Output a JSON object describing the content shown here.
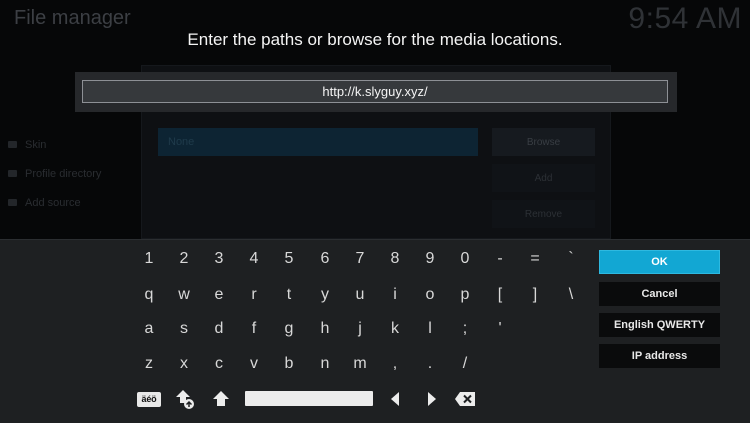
{
  "background": {
    "title": "File manager",
    "clock": "9:54 AM",
    "sidebar_items": [
      "Skin",
      "Profile directory",
      "Add source"
    ],
    "list_first_item": "None",
    "buttons": [
      "Browse",
      "Add",
      "Remove"
    ]
  },
  "dialog": {
    "heading": "Enter the paths or browse for the media locations.",
    "path_value": "http://k.slyguy.xyz/"
  },
  "keyboard": {
    "rows": [
      [
        "1",
        "2",
        "3",
        "4",
        "5",
        "6",
        "7",
        "8",
        "9",
        "0",
        "-",
        "=",
        "`"
      ],
      [
        "q",
        "w",
        "e",
        "r",
        "t",
        "y",
        "u",
        "i",
        "o",
        "p",
        "[",
        "]",
        "\\"
      ],
      [
        "a",
        "s",
        "d",
        "f",
        "g",
        "h",
        "j",
        "k",
        "l",
        ";",
        "'"
      ],
      [
        "z",
        "x",
        "c",
        "v",
        "b",
        "n",
        "m",
        ",",
        ".",
        "/"
      ]
    ],
    "accent_label": "äéö",
    "icons": [
      "capslock-icon",
      "shift-icon",
      "arrow-left-icon",
      "arrow-right-icon",
      "backspace-icon"
    ]
  },
  "actions": {
    "ok": "OK",
    "cancel": "Cancel",
    "layout": "English QWERTY",
    "ip": "IP address"
  },
  "colors": {
    "focus": "#12a7d3",
    "panel": "#1e2022",
    "button": "#0a0b0c"
  }
}
